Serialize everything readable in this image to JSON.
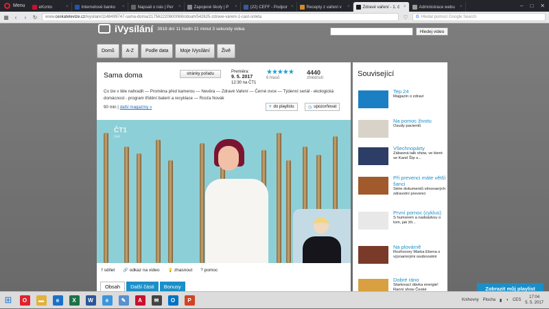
{
  "browser": {
    "menu_label": "Menu",
    "tabs": [
      {
        "label": "eKonto",
        "color": "#c8102e",
        "active": false
      },
      {
        "label": "Internetové banko",
        "color": "#2255aa",
        "active": false
      },
      {
        "label": "Napsali o nás | Per",
        "color": "#666666",
        "active": false
      },
      {
        "label": "Zapojené školy | P",
        "color": "#888888",
        "active": false
      },
      {
        "label": "(22) CEFF - Podpor",
        "color": "#3b5998",
        "active": false
      },
      {
        "label": "Recepty z vaření v",
        "color": "#d08a2c",
        "active": false
      },
      {
        "label": "Zdravé vaření - 1. č",
        "color": "#1a1a1a",
        "active": true
      },
      {
        "label": "Administrace webu",
        "color": "#999999",
        "active": false
      }
    ],
    "url_prefix": "www.",
    "url_domain": "ceskatelevize.cz",
    "url_path": "/ivysilani/1148499747-sama-doma/217562220600068/obsah/542625-zdrave-vareni-1-cast-snleta",
    "search_placeholder": "Hledat pomocí Google Search"
  },
  "site": {
    "logo": "iVysílání",
    "stats": "3918 dní 11 hodin 21 minut 3 sekundy videa",
    "search_button": "Hledej video",
    "nav": [
      "Domů",
      "A-Z",
      "Podle data",
      "Moje iVysílání",
      "Živě"
    ]
  },
  "show": {
    "title": "Sama doma",
    "pages_button": "stránky pořadu",
    "premiere_label": "Premiéra:",
    "premiere_date": "9. 5. 2017",
    "premiere_time": "12:30 na ČT1",
    "votes": "6 hlasů",
    "views_count": "4440",
    "views_label": "zhlédnutí",
    "description": "Co lze v těle nahradit — Proměna před kamerou — Nevěra — Zdravé Vaření — Černé ovce — Týdenní seriál - ekologická domácnost - program třídění baterií a recyklace — Rosťa Novák",
    "duration": "90 min",
    "more_link": "další magazíny »",
    "playlist_button": "do playlistu",
    "remind_button": "upozorňovat",
    "video_logo": "ČT1",
    "video_live": "živě"
  },
  "actions": [
    {
      "label": "sdílet",
      "icon": "facebook-icon"
    },
    {
      "label": "odkaz na video",
      "icon": "link-icon"
    },
    {
      "label": "zhasnout",
      "icon": "bulb-icon"
    },
    {
      "label": "pomoc",
      "icon": "help-icon"
    }
  ],
  "content_tabs": [
    "Obsah",
    "Další části",
    "Bonusy"
  ],
  "sidebar": {
    "title": "Související",
    "items": [
      {
        "name": "Tep 24",
        "desc": "Magazín o zdraví",
        "thumb": "#1b7fc4"
      },
      {
        "name": "Na pomoc životu",
        "desc": "Osudy pacientů",
        "thumb": "#d8d2c8"
      },
      {
        "name": "Všechnopárty",
        "desc": "Zábavná talk show, ve které se Karel Šíp s...",
        "thumb": "#2c3d66"
      },
      {
        "name": "Při prevenci máte větší šanci",
        "desc": "Série dokumentů věnovaných zdravotní prevenci",
        "thumb": "#a05a2c"
      },
      {
        "name": "První pomoc (cyklus)",
        "desc": "S humorem a nadsázkou o tom, jak žít...",
        "thumb": "#e8e8e8"
      },
      {
        "name": "Na plovárně",
        "desc": "Rozhovory Marka Ebena s významnými osobnostmi",
        "thumb": "#7a3a2a"
      },
      {
        "name": "Dobré ráno",
        "desc": "Startovací dávka energie! Ranní show České",
        "thumb": "#d8a040"
      }
    ]
  },
  "playlist_cta": "Zobrazit můj playlist",
  "taskbar": {
    "apps": [
      {
        "icon": "opera-icon",
        "color": "#e0222d",
        "glyph": "O"
      },
      {
        "icon": "folder-icon",
        "color": "#e2b23c",
        "glyph": "▬"
      },
      {
        "icon": "ie-icon",
        "color": "#1a72c8",
        "glyph": "e"
      },
      {
        "icon": "excel-icon",
        "color": "#1e7145",
        "glyph": "X"
      },
      {
        "icon": "word-icon",
        "color": "#2b579a",
        "glyph": "W"
      },
      {
        "icon": "edge-icon",
        "color": "#3a96dd",
        "glyph": "e"
      },
      {
        "icon": "paint-icon",
        "color": "#5a8fd0",
        "glyph": "✎"
      },
      {
        "icon": "acrobat-icon",
        "color": "#c8102e",
        "glyph": "A"
      },
      {
        "icon": "mail-icon",
        "color": "#444444",
        "glyph": "✉"
      },
      {
        "icon": "outlook-icon",
        "color": "#0072c6",
        "glyph": "O"
      },
      {
        "icon": "powerpoint-icon",
        "color": "#d04423",
        "glyph": "P"
      }
    ],
    "tray_left": "Knihovny",
    "tray_desktop": "Plocha",
    "lang": "CES",
    "time": "17:04",
    "date": "5. 5. 2017"
  }
}
